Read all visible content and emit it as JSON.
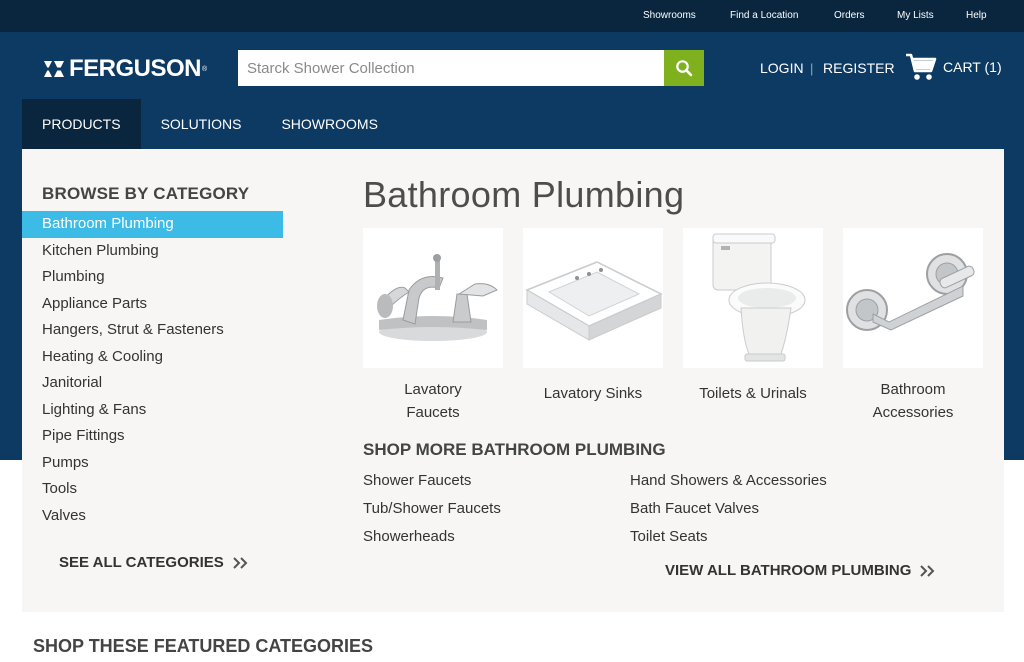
{
  "utility_nav": [
    "Showrooms",
    "Find a Location",
    "Orders",
    "My Lists",
    "Help"
  ],
  "brand": {
    "name": "FERGUSON",
    "reg": "®"
  },
  "search": {
    "placeholder": "Starck Shower Collection",
    "value": "",
    "icon": "search-icon",
    "button_color": "#7fb11f"
  },
  "account": {
    "login": "LOGIN",
    "separator": "|",
    "register": "REGISTER"
  },
  "cart": {
    "label": "CART (1)",
    "icon": "cart-icon"
  },
  "main_nav": {
    "items": [
      "PRODUCTS",
      "SOLUTIONS",
      "SHOWROOMS"
    ],
    "active": "PRODUCTS"
  },
  "browse": {
    "title": "BROWSE BY CATEGORY",
    "categories": [
      "Bathroom Plumbing",
      "Kitchen Plumbing",
      "Plumbing",
      "Appliance Parts",
      "Hangers, Strut & Fasteners",
      "Heating & Cooling",
      "Janitorial",
      "Lighting & Fans",
      "Pipe Fittings",
      "Pumps",
      "Tools",
      "Valves"
    ],
    "active": "Bathroom Plumbing",
    "see_all": "SEE ALL CATEGORIES"
  },
  "section": {
    "title": "Bathroom Plumbing",
    "tiles": [
      {
        "line1": "Lavatory",
        "line2": "Faucets",
        "image": "faucet"
      },
      {
        "line1": "Lavatory Sinks",
        "line2": "",
        "image": "sink"
      },
      {
        "line1": "Toilets & Urinals",
        "line2": "",
        "image": "toilet"
      },
      {
        "line1": "Bathroom",
        "line2": "Accessories",
        "image": "paper-holder"
      }
    ],
    "shop_more_title": "SHOP MORE BATHROOM PLUMBING",
    "links_left": [
      "Shower Faucets",
      "Tub/Shower Faucets",
      "Showerheads"
    ],
    "links_right": [
      "Hand Showers & Accessories",
      "Bath Faucet Valves",
      "Toilet Seats"
    ],
    "view_all": "VIEW ALL BATHROOM PLUMBING"
  },
  "featured_title": "SHOP THESE FEATURED CATEGORIES",
  "colors": {
    "header": "#0d3a63",
    "topbar": "#09263e",
    "active_category": "#3bbbe5",
    "panel": "#f7f6f5"
  }
}
